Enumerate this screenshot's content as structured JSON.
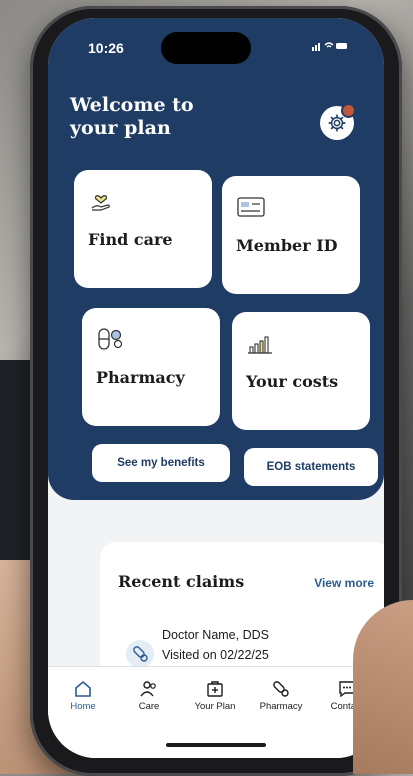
{
  "status": {
    "time": "10:26",
    "icons": "..ıl ≈ ▬"
  },
  "header": {
    "title": "Welcome to your plan",
    "settings_icon": "gear-icon"
  },
  "tiles": [
    {
      "label": "Find care",
      "icon": "heart-hand-icon"
    },
    {
      "label": "Member ID",
      "icon": "id-card-icon"
    },
    {
      "label": "Pharmacy",
      "icon": "pills-icon"
    },
    {
      "label": "Your costs",
      "icon": "bar-chart-icon"
    }
  ],
  "buttons": {
    "benefits": "See my benefits",
    "eob": "EOB statements"
  },
  "recent_claims": {
    "title": "Recent claims",
    "view_more": "View more",
    "items": [
      {
        "name": "Doctor Name, DDS",
        "date": "Visited on 02/22/25"
      }
    ]
  },
  "nav": [
    {
      "label": "Home",
      "icon": "home-icon",
      "active": true
    },
    {
      "label": "Care",
      "icon": "people-icon"
    },
    {
      "label": "Your Plan",
      "icon": "plan-icon"
    },
    {
      "label": "Pharmacy",
      "icon": "pill-icon"
    },
    {
      "label": "Contact",
      "icon": "chat-icon"
    }
  ],
  "colors": {
    "primary": "#1f3c64",
    "accent": "#2c5c8f",
    "alert": "#c2553a"
  }
}
